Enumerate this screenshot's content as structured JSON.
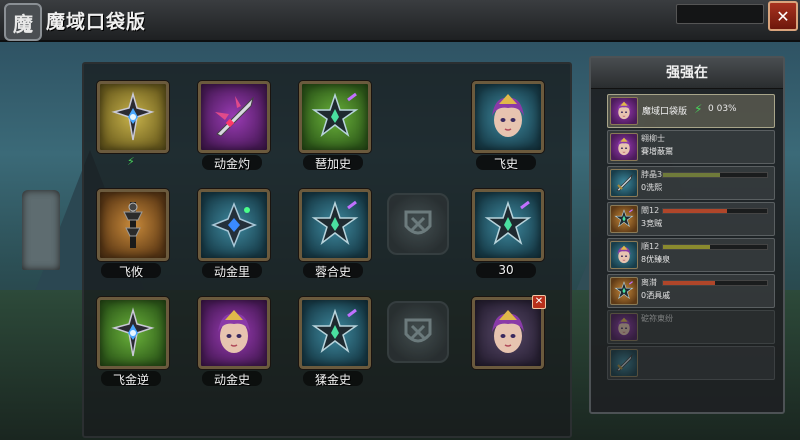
{
  "app": {
    "logo_char": "魔",
    "title": "魔域口袋版",
    "close_label": "✕"
  },
  "grid": {
    "slots": [
      {
        "row": 0,
        "col": 0,
        "kind": "item",
        "bg": "yellow",
        "icon": "cross-staff-icon",
        "label": "",
        "has_bolt": true,
        "bolt": "⚡"
      },
      {
        "row": 0,
        "col": 1,
        "kind": "item",
        "bg": "purple",
        "icon": "winged-blade-icon",
        "label": "动金灼"
      },
      {
        "row": 0,
        "col": 2,
        "kind": "item",
        "bg": "green",
        "icon": "star-staff-icon",
        "label": "琶加史"
      },
      {
        "row": 0,
        "col": 3,
        "kind": "blank",
        "label": ""
      },
      {
        "row": 0,
        "col": 4,
        "kind": "hero",
        "bg": "teal",
        "icon": "hero-portrait-icon",
        "label": "飞史"
      },
      {
        "row": 1,
        "col": 0,
        "kind": "item",
        "bg": "orange",
        "icon": "dark-staff-icon",
        "label": "飞攸"
      },
      {
        "row": 1,
        "col": 1,
        "kind": "item",
        "bg": "teal",
        "icon": "gem-cross-icon",
        "label": "动金里"
      },
      {
        "row": 1,
        "col": 2,
        "kind": "item",
        "bg": "teal",
        "icon": "star-staff-icon",
        "label": "蓉合史"
      },
      {
        "row": 1,
        "col": 3,
        "kind": "empty",
        "icon": "emblem-icon",
        "label": ""
      },
      {
        "row": 1,
        "col": 4,
        "kind": "item",
        "bg": "teal",
        "icon": "star-staff-icon",
        "label": "30"
      },
      {
        "row": 2,
        "col": 0,
        "kind": "item",
        "bg": "green",
        "icon": "cross-staff-icon",
        "label": "飞金逆"
      },
      {
        "row": 2,
        "col": 1,
        "kind": "hero",
        "bg": "purple",
        "icon": "hero-portrait-icon",
        "label": "动金史"
      },
      {
        "row": 2,
        "col": 2,
        "kind": "item",
        "bg": "teal",
        "icon": "star-staff-icon",
        "label": "猱金史"
      },
      {
        "row": 2,
        "col": 3,
        "kind": "empty",
        "icon": "emblem-icon",
        "label": ""
      },
      {
        "row": 2,
        "col": 4,
        "kind": "hero",
        "bg": "dark",
        "icon": "hero-portrait-icon",
        "label": "",
        "has_close": true,
        "close_badge": "✕"
      }
    ]
  },
  "panel": {
    "title": "强强在",
    "rows": [
      {
        "icon": "hero-portrait-icon",
        "bg": "purple",
        "active": true,
        "text1": "魔域口袋版",
        "bolt": "⚡",
        "value": "0 03%"
      },
      {
        "icon": "hero-portrait-icon",
        "bg": "purple",
        "text1": "翱柳士",
        "text2": "賽增蔽鬻"
      },
      {
        "icon": "sword-icon",
        "bg": "teal",
        "text1": "脖晶3",
        "text2": "0洗熙",
        "bar_color": "#6f7a3a",
        "bar": 0.55
      },
      {
        "icon": "star-staff-icon",
        "bg": "orange",
        "text1": "閘12",
        "text2": "3竞贼",
        "bar_color": "#b0462a",
        "bar": 0.62
      },
      {
        "icon": "hero-portrait-icon",
        "bg": "teal",
        "text1": "順12",
        "text2": "8优臻泉",
        "bar_color": "#8a8a2e",
        "bar": 0.45
      },
      {
        "icon": "star-staff-icon",
        "bg": "orange",
        "text1": "离潸",
        "text2": "0洒具戚",
        "bar_color": "#b0462a",
        "bar": 0.5
      },
      {
        "icon": "hero-portrait-icon",
        "bg": "purple",
        "text1": "砨祢東纷",
        "faded": true
      },
      {
        "icon": "sword-icon",
        "bg": "teal",
        "text1": "",
        "faded": true
      }
    ]
  }
}
